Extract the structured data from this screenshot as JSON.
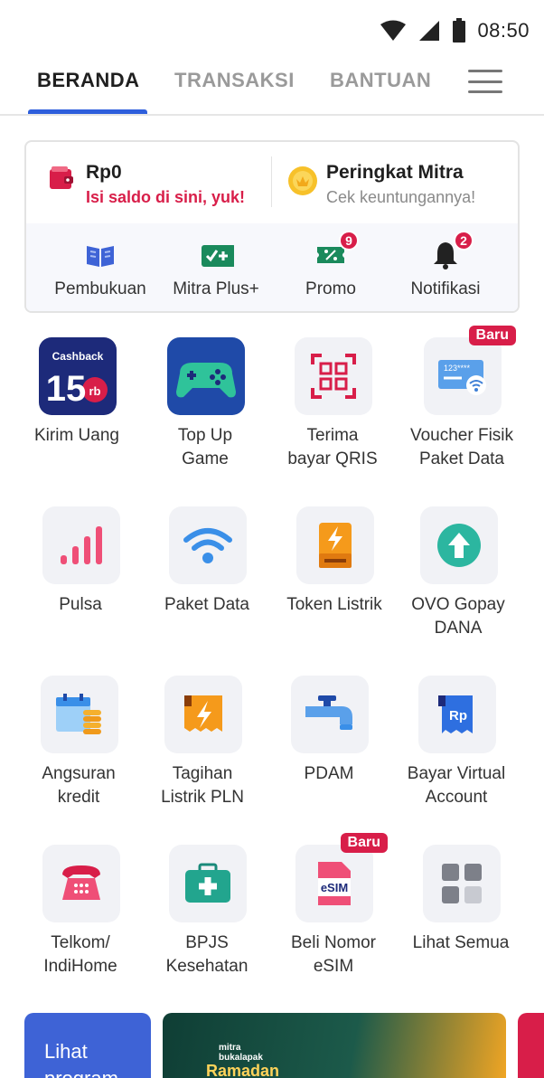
{
  "status_bar": {
    "time": "08:50"
  },
  "tabs": [
    {
      "label": "BERANDA"
    },
    {
      "label": "TRANSAKSI"
    },
    {
      "label": "BANTUAN"
    }
  ],
  "wallet": {
    "balance": "Rp0",
    "balance_hint": "Isi saldo di sini, yuk!",
    "rank_title": "Peringkat Mitra",
    "rank_hint": "Cek keuntungannya!"
  },
  "quick_actions": [
    {
      "label": "Pembukuan",
      "icon": "book-icon"
    },
    {
      "label": "Mitra Plus+",
      "icon": "mitra-plus-icon"
    },
    {
      "label": "Promo",
      "icon": "promo-ticket-icon",
      "badge": "9"
    },
    {
      "label": "Notifikasi",
      "icon": "bell-icon",
      "badge": "2"
    }
  ],
  "menu": [
    {
      "label": "Kirim Uang",
      "icon": "cashback-icon",
      "icon_text": [
        "Cashback",
        "15",
        "rb"
      ]
    },
    {
      "label": "Top Up\nGame",
      "icon": "gamepad-icon"
    },
    {
      "label": "Terima\nbayar QRIS",
      "icon": "qris-scan-icon"
    },
    {
      "label": "Voucher Fisik\nPaket Data",
      "icon": "voucher-card-icon",
      "badge": "Baru",
      "icon_text": [
        "123****"
      ]
    },
    {
      "label": "Pulsa",
      "icon": "signal-bars-icon"
    },
    {
      "label": "Paket Data",
      "icon": "wifi-icon"
    },
    {
      "label": "Token Listrik",
      "icon": "electric-token-icon"
    },
    {
      "label": "OVO Gopay\nDANA",
      "icon": "upload-arrow-icon"
    },
    {
      "label": "Angsuran\nkredit",
      "icon": "calendar-coins-icon"
    },
    {
      "label": "Tagihan\nListrik PLN",
      "icon": "electric-bill-icon"
    },
    {
      "label": "PDAM",
      "icon": "water-tap-icon"
    },
    {
      "label": "Bayar Virtual\nAccount",
      "icon": "virtual-account-icon",
      "icon_text": [
        "Rp"
      ]
    },
    {
      "label": "Telkom/\nIndiHome",
      "icon": "telephone-icon"
    },
    {
      "label": "BPJS\nKesehatan",
      "icon": "medical-kit-icon"
    },
    {
      "label": "Beli Nomor\neSIM",
      "icon": "esim-icon",
      "badge": "Baru",
      "icon_text": [
        "eSIM"
      ]
    },
    {
      "label": "Lihat Semua",
      "icon": "grid-icon"
    }
  ],
  "banners": {
    "left_text": "Lihat\nprogram",
    "main_brand": [
      "mitra",
      "bukalapak"
    ],
    "main_title": "Ramadan"
  },
  "colors": {
    "accent_blue": "#2e5fdc",
    "accent_red": "#d81e49",
    "tile_bg": "#f1f2f6"
  }
}
